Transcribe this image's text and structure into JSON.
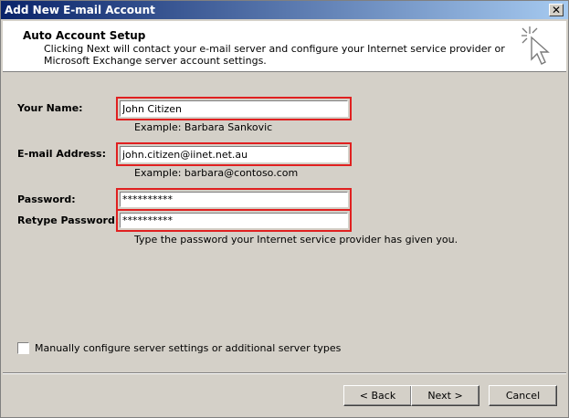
{
  "window": {
    "title": "Add New E-mail Account",
    "close_label": "✕"
  },
  "header": {
    "title": "Auto Account Setup",
    "description": "Clicking Next will contact your e-mail server and configure your Internet service provider or Microsoft Exchange server account settings.",
    "icon": "cursor-sparkle-icon"
  },
  "form": {
    "name": {
      "label": "Your Name:",
      "value": "John Citizen",
      "hint": "Example: Barbara Sankovic"
    },
    "email": {
      "label": "E-mail Address:",
      "value": "john.citizen@iinet.net.au",
      "hint": "Example: barbara@contoso.com"
    },
    "password": {
      "label": "Password:",
      "value": "**********"
    },
    "retype_password": {
      "label": "Retype Password:",
      "value": "**********",
      "hint": "Type the password your Internet service provider has given you."
    }
  },
  "manual_config": {
    "label": "Manually configure server settings or additional server types",
    "checked": false
  },
  "buttons": {
    "back": "< Back",
    "next": "Next >",
    "cancel": "Cancel"
  },
  "colors": {
    "highlight_border": "#e02020",
    "dialog_bg": "#d4d0c8",
    "titlebar": "#0a246a"
  }
}
